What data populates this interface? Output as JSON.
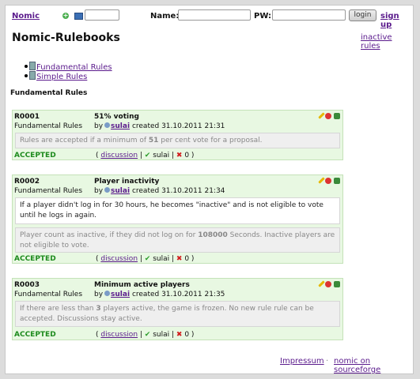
{
  "header": {
    "brand": "Nomic",
    "name_label": "Name:",
    "pw_label": "PW:",
    "login_label": "login",
    "signup_label": "sign up"
  },
  "page": {
    "title": "Nomic-Rulebooks",
    "inactive_link": "inactive rules",
    "rulebooks": [
      "Fundamental Rules",
      "Simple Rules"
    ],
    "section_title": "Fundamental Rules"
  },
  "rules": [
    {
      "id": "R0001",
      "book": "Fundamental Rules",
      "title": "51% voting",
      "by": "by",
      "author": "sulai",
      "created": "created 31.10.2011 21:31",
      "proposal_pre": "Rules are accepted if a minimum of ",
      "proposal_bold": "51",
      "proposal_post": " per cent vote for a proposal.",
      "status": "ACCEPTED",
      "discussion": "discussion",
      "voter": "sulai",
      "against": "0"
    },
    {
      "id": "R0002",
      "book": "Fundamental Rules",
      "title": "Player inactivity",
      "by": "by",
      "author": "sulai",
      "created": "created 31.10.2011 21:34",
      "text": "If a player didn't log in for 30 hours, he becomes \"inactive\" and is not eligible to vote until he logs in again.",
      "proposal_pre": "Player count as inactive, if they did not log on for ",
      "proposal_bold": "108000",
      "proposal_post": " Seconds. Inactive players are not eligible to vote.",
      "status": "ACCEPTED",
      "discussion": "discussion",
      "voter": "sulai",
      "against": "0"
    },
    {
      "id": "R0003",
      "book": "Fundamental Rules",
      "title": "Minimum active players",
      "by": "by",
      "author": "sulai",
      "created": "created 31.10.2011 21:35",
      "proposal_pre": "If there are less than ",
      "proposal_bold": "3",
      "proposal_post": " players active, the game is frozen. No new rule rule can be accepted. Discussions stay active.",
      "status": "ACCEPTED",
      "discussion": "discussion",
      "voter": "sulai",
      "against": "0"
    }
  ],
  "footer": {
    "impressum": "Impressum",
    "separator": "·",
    "sourceforge": "nomic on sourceforge"
  },
  "colors": {
    "card_bg": "#e8f8e2",
    "accepted": "#1e8b1e",
    "link": "#5a1a8c"
  }
}
